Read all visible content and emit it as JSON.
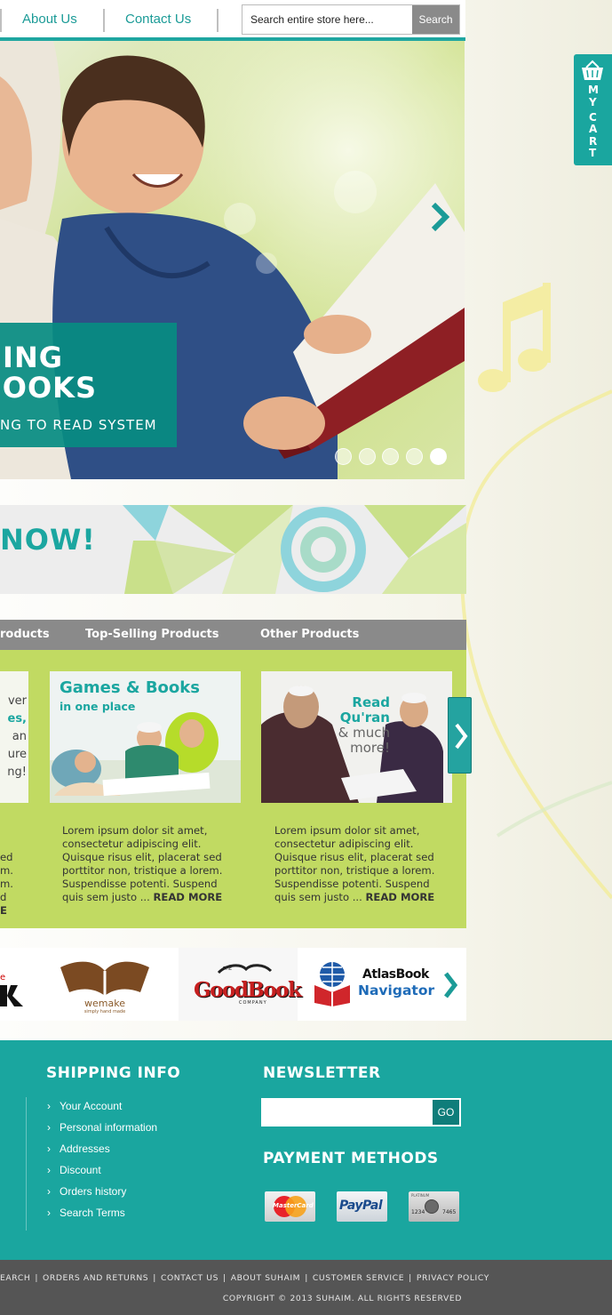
{
  "nav": {
    "items": [
      {
        "label": "About Us"
      },
      {
        "label": "Contact Us"
      }
    ]
  },
  "search": {
    "placeholder": "Search entire store here...",
    "button_label": "Search"
  },
  "hero": {
    "line1": "NING",
    "line2": "BOOKS",
    "subtitle": "NG TO READ SYSTEM",
    "slides_count": 5,
    "active_slide": 5
  },
  "promo": {
    "text": "NOW!"
  },
  "tabs": [
    {
      "label": "roducts"
    },
    {
      "label": "Top-Selling Products"
    },
    {
      "label": "Other Products"
    }
  ],
  "products": [
    {
      "image_title": "Games & Books",
      "image_subtitle": "in one place",
      "description": "Lorem ipsum dolor sit amet, consectetur adipiscing elit. Quisque risus elit, placerat sed porttitor non, tristique a lorem. Suspendisse potenti. Suspend quis sem justo ...",
      "read_more": "READ MORE"
    },
    {
      "image_title_1": "Read",
      "image_title_2": "Qu'ran",
      "image_subtitle_1": "& much",
      "image_subtitle_2": "more!",
      "description": "Lorem ipsum dolor sit amet, consectetur adipiscing elit. Quisque risus elit, placerat sed porttitor non, tristique a lorem. Suspendisse potenti. Suspend quis sem justo ...",
      "read_more": "READ MORE"
    }
  ],
  "partial_product": {
    "img_lines": [
      "ver",
      "es,",
      "an",
      "ure",
      "ng!"
    ],
    "text_lines": [
      "ed",
      "m.",
      "m.",
      "d",
      "E"
    ]
  },
  "brands": [
    {
      "name": "wemake",
      "tagline": "simply hand made"
    },
    {
      "name": "GoodBook",
      "prefix": "THE",
      "suffix": "COMPANY"
    },
    {
      "name_1": "AtlasBook",
      "name_2": "Navigator"
    }
  ],
  "footer": {
    "shipping_title": "SHIPPING INFO",
    "shipping_links": [
      "Your Account",
      "Personal information",
      "Addresses",
      "Discount",
      "Orders history",
      "Search Terms"
    ],
    "newsletter_title": "NEWSLETTER",
    "newsletter_button": "GO",
    "payment_title": "PAYMENT METHODS",
    "payment_methods": [
      "MasterCard",
      "PayPal",
      "American Express"
    ],
    "amex_digits_1": "1234",
    "amex_digits_2": "7465",
    "amex_label": "PLATINUM"
  },
  "bottom": {
    "links": [
      "EARCH",
      "ORDERS AND RETURNS",
      "CONTACT US",
      "ABOUT SUHAIM",
      "CUSTOMER SERVICE",
      "PRIVACY POLICY"
    ],
    "copyright": "COPYRIGHT © 2013 SUHAIM. ALL RIGHTS RESERVED"
  },
  "cart": {
    "letters": [
      "M",
      "Y",
      "C",
      "A",
      "R",
      "T"
    ]
  },
  "colors": {
    "accent": "#1aa69f",
    "green": "#c1da62",
    "gray": "#8a8a8a"
  }
}
